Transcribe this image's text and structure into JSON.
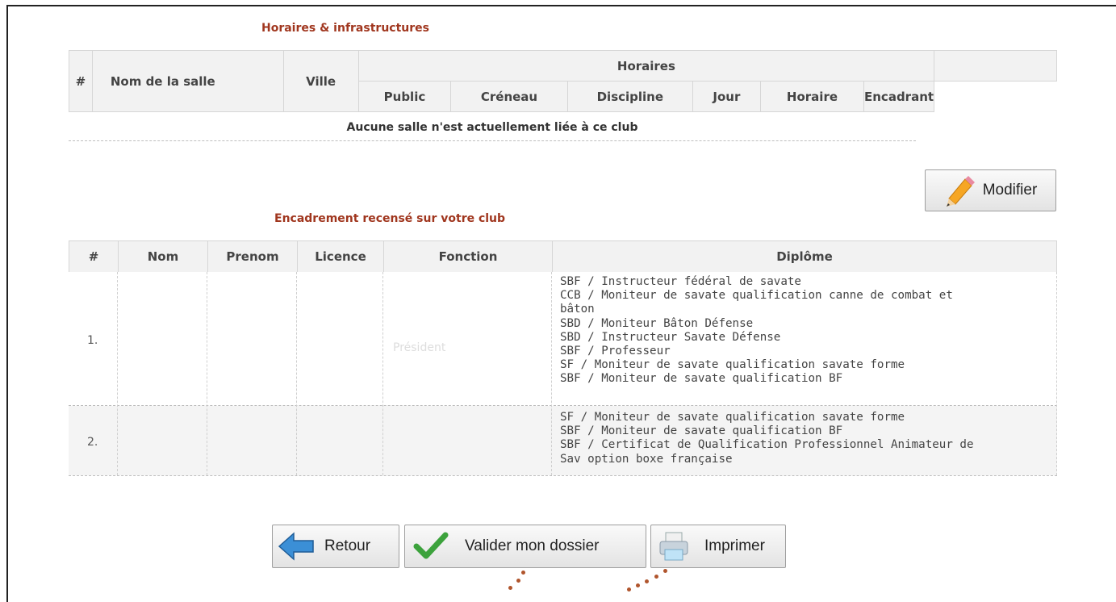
{
  "horaires": {
    "title": "Horaires & infrastructures",
    "headers": {
      "num": "#",
      "nom_salle": "Nom de la salle",
      "ville": "Ville",
      "horaires": "Horaires",
      "public": "Public",
      "creneau": "Créneau",
      "discipline": "Discipline",
      "jour": "Jour",
      "horaire": "Horaire",
      "encadrant": "Encadrant"
    },
    "empty_message": "Aucune salle n'est actuellement liée à ce club"
  },
  "modify_button": {
    "label": "Modifier",
    "icon": "pencil-icon"
  },
  "encadrement": {
    "title": "Encadrement recensé sur votre club",
    "headers": {
      "num": "#",
      "nom": "Nom",
      "prenom": "Prenom",
      "licence": "Licence",
      "fonction": "Fonction",
      "diplome": "Diplôme"
    },
    "rows": [
      {
        "num": "1.",
        "fonction": "Président",
        "diplomes": [
          "SBF / Instructeur fédéral de savate",
          "CCB / Moniteur de savate qualification canne de combat et",
          "bâton",
          "SBD / Moniteur Bâton Défense",
          "SBD / Instructeur Savate Défense",
          "SBF / Professeur",
          "SF / Moniteur de savate qualification savate forme",
          "SBF / Moniteur de savate qualification BF"
        ]
      },
      {
        "num": "2.",
        "fonction": "",
        "diplomes": [
          "SF / Moniteur de savate qualification savate forme",
          "SBF / Moniteur de savate qualification BF",
          "SBF / Certificat de Qualification Professionnel Animateur de",
          "Sav option boxe française"
        ]
      }
    ]
  },
  "actions": {
    "retour": "Retour",
    "valider": "Valider mon dossier",
    "imprimer": "Imprimer"
  },
  "colors": {
    "section_title": "#a0361e",
    "header_bg": "#f2f2f2",
    "row_alt_bg": "#f4f4f4"
  }
}
